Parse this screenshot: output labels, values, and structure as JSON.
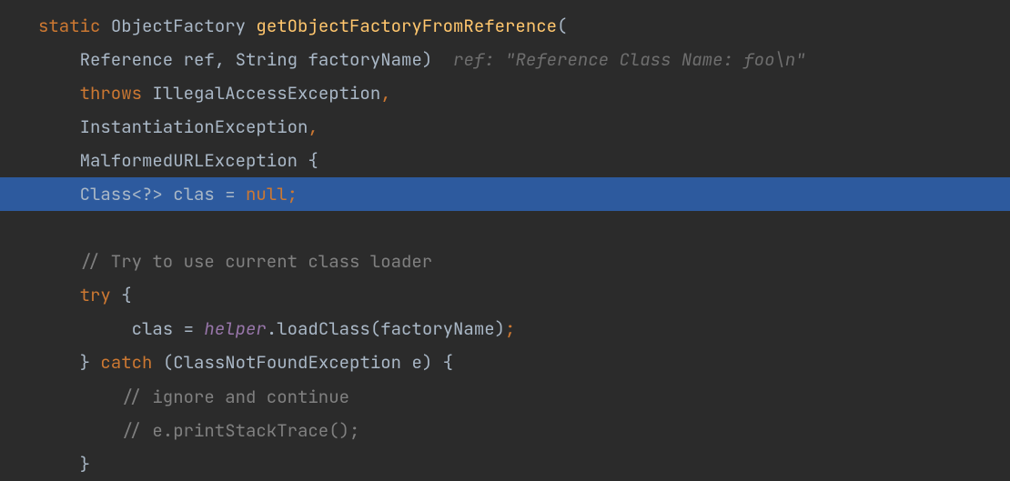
{
  "code": {
    "line1": {
      "keyword": "static",
      "type": "ObjectFactory",
      "method": "getObjectFactoryFromReference",
      "paren_open": "("
    },
    "line2": {
      "indent": "    ",
      "param1_type": "Reference",
      "param1_name": " ref",
      "comma1": ", ",
      "param2_type": "String",
      "param2_name": " factoryName",
      "paren_close": ")",
      "hint": "  ref: \"Reference Class Name: foo\\n\""
    },
    "line3": {
      "indent": "    ",
      "throws_kw": "throws",
      "exception": " IllegalAccessException",
      "comma": ","
    },
    "line4": {
      "indent": "    ",
      "exception": "InstantiationException",
      "comma": ","
    },
    "line5": {
      "indent": "    ",
      "exception": "MalformedURLException ",
      "brace": "{"
    },
    "line6": {
      "indent": "    ",
      "type": "Class<?>",
      "var": " clas = ",
      "null_kw": "null",
      "semi": ";"
    },
    "line7": {
      "indent": "    ",
      "comment": "// Try to use current class loader"
    },
    "line8": {
      "indent": "    ",
      "try_kw": "try",
      "brace": " {"
    },
    "line9": {
      "indent": "         ",
      "var": "clas = ",
      "field": "helper",
      "method_call": ".loadClass(factoryName)",
      "semi": ";"
    },
    "line10": {
      "indent": "    ",
      "brace_close": "} ",
      "catch_kw": "catch",
      "catch_params": " (ClassNotFoundException e) {"
    },
    "line11": {
      "indent": "        ",
      "comment": "// ignore and continue"
    },
    "line12": {
      "indent": "        ",
      "comment": "// e.printStackTrace();"
    },
    "line13": {
      "indent": "    ",
      "brace": "}"
    }
  }
}
